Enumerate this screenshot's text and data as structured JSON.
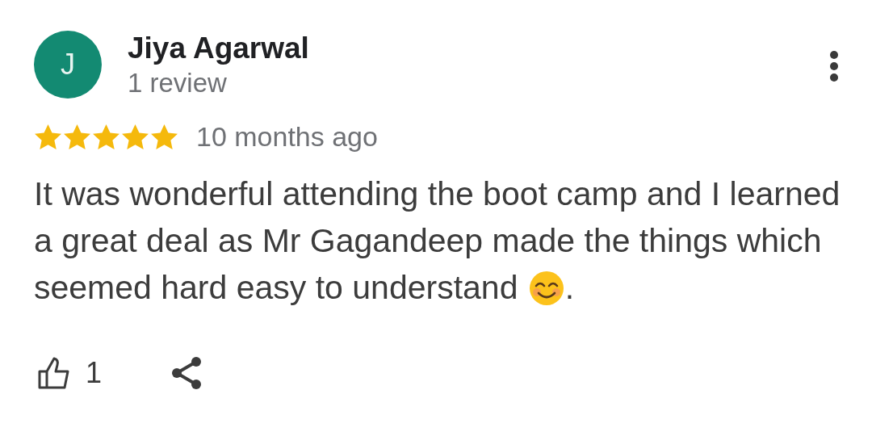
{
  "reviewer": {
    "initial": "J",
    "name": "Jiya Agarwal",
    "review_count": "1 review"
  },
  "rating": {
    "stars": 5,
    "time": "10 months ago"
  },
  "review": {
    "text": "It was wonderful attending the boot camp and I learned a great deal as Mr Gagandeep made the things which seemed hard easy to understand ",
    "end": "."
  },
  "actions": {
    "likes": "1"
  }
}
